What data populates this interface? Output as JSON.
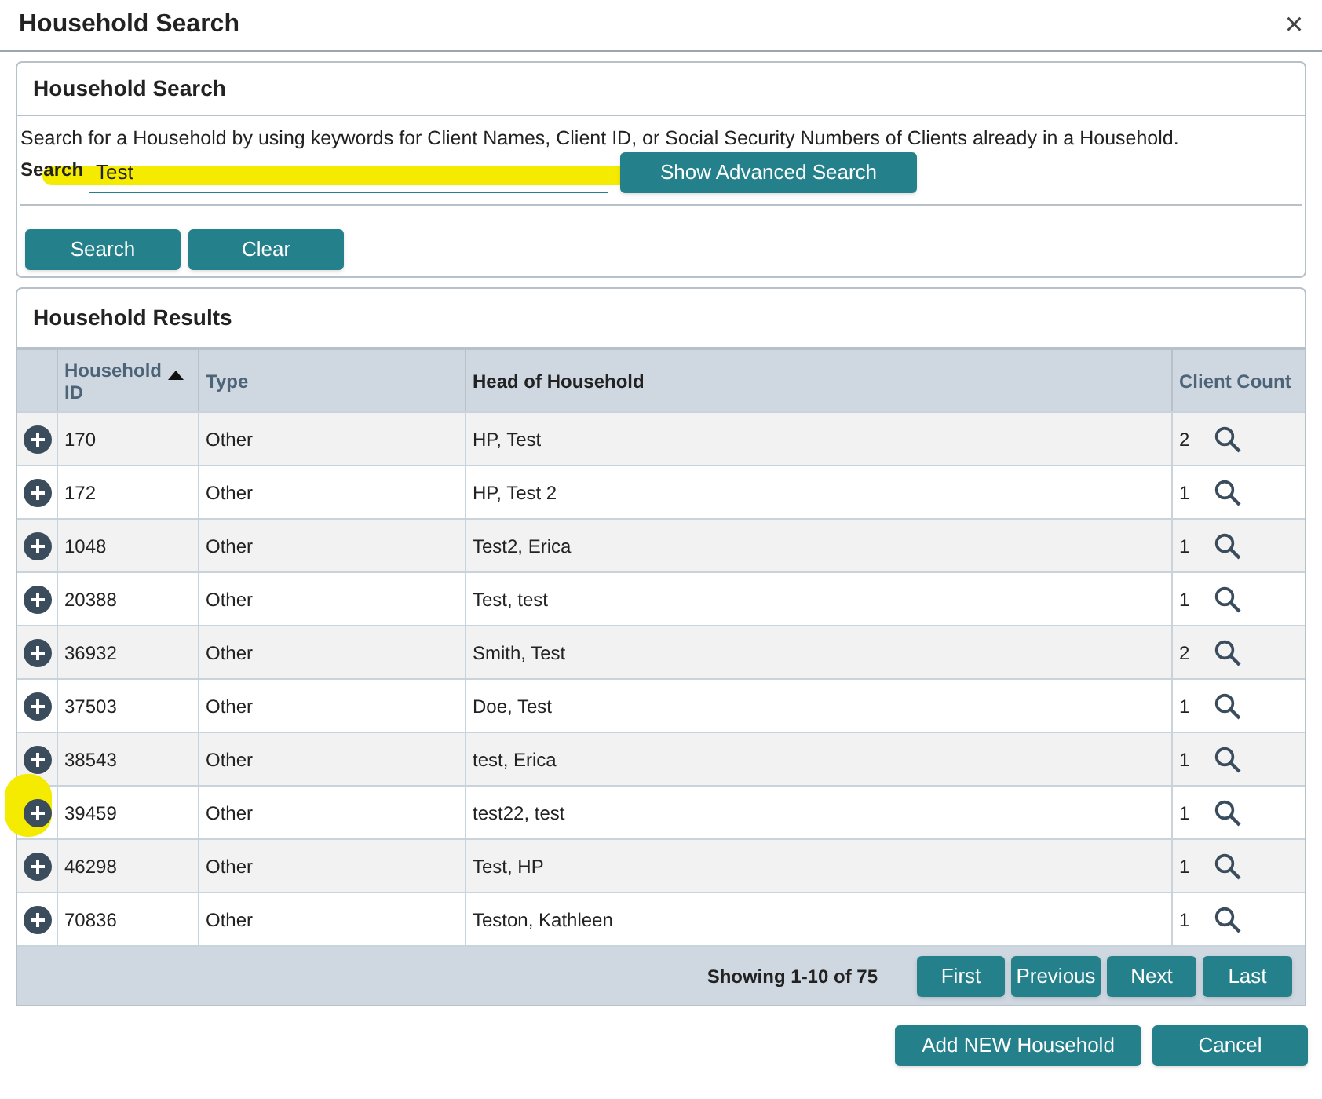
{
  "window": {
    "title": "Household Search",
    "close": "×"
  },
  "search_panel": {
    "title": "Household Search",
    "description": "Search for a Household by using keywords for Client Names, Client ID, or Social Security Numbers of Clients already in a Household.",
    "label": "Search",
    "value": "Test",
    "highlighted": true,
    "advanced_button": "Show Advanced Search",
    "buttons": [
      "Search",
      "Clear"
    ]
  },
  "results_panel": {
    "title": "Household Results",
    "columns": [
      {
        "label": "Household ID",
        "sorted": true
      },
      {
        "label": "Type",
        "sorted": false
      },
      {
        "label": "Head of Household",
        "sorted": false
      },
      {
        "label": "Client Count",
        "sorted": false
      }
    ],
    "rows": [
      {
        "id": "170",
        "type": "Other",
        "head": "HP, Test",
        "count": "2",
        "highlighted": false
      },
      {
        "id": "172",
        "type": "Other",
        "head": "HP, Test 2",
        "count": "1",
        "highlighted": false
      },
      {
        "id": "1048",
        "type": "Other",
        "head": "Test2, Erica",
        "count": "1",
        "highlighted": false
      },
      {
        "id": "20388",
        "type": "Other",
        "head": "Test, test",
        "count": "1",
        "highlighted": false
      },
      {
        "id": "36932",
        "type": "Other",
        "head": "Smith, Test",
        "count": "2",
        "highlighted": false
      },
      {
        "id": "37503",
        "type": "Other",
        "head": "Doe, Test",
        "count": "1",
        "highlighted": false
      },
      {
        "id": "38543",
        "type": "Other",
        "head": "test, Erica",
        "count": "1",
        "highlighted": false
      },
      {
        "id": "39459",
        "type": "Other",
        "head": "test22, test",
        "count": "1",
        "highlighted": true
      },
      {
        "id": "46298",
        "type": "Other",
        "head": "Test, HP",
        "count": "1",
        "highlighted": false
      },
      {
        "id": "70836",
        "type": "Other",
        "head": "Teston, Kathleen",
        "count": "1",
        "highlighted": false
      }
    ],
    "paging_info": "Showing 1-10 of 75",
    "paging_buttons": [
      "First",
      "Previous",
      "Next",
      "Last"
    ]
  },
  "footer_buttons": [
    "Add NEW Household",
    "Cancel"
  ]
}
